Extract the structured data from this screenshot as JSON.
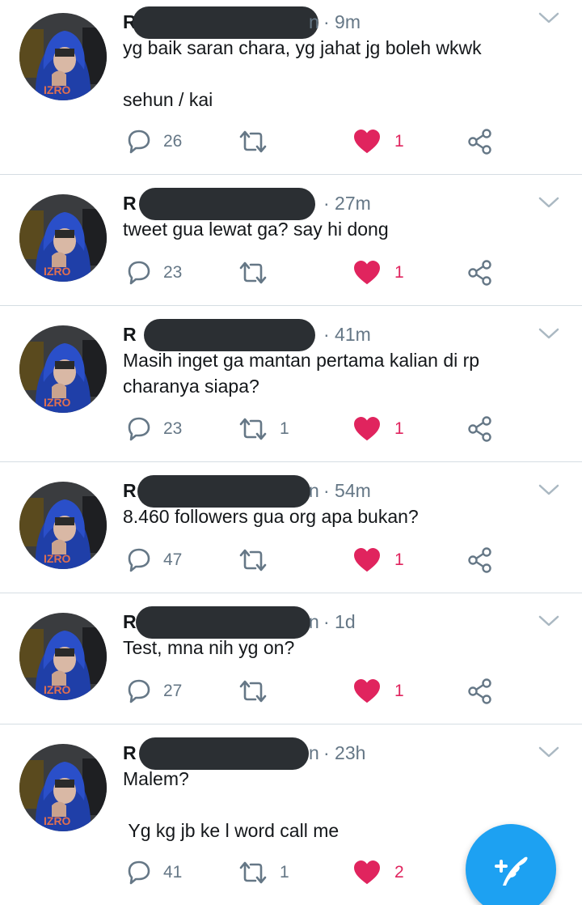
{
  "colors": {
    "accent": "#1da1f2",
    "like_active": "#e0245e",
    "secondary_text": "#657786",
    "divider": "#d5dde3",
    "redaction": "#2b2f33"
  },
  "tweets": [
    {
      "name_start": "R",
      "handle_end": "n",
      "time": "· 9m",
      "text": "yg baik saran chara, yg jahat jg boleh wkwk\n\nsehun / kai",
      "replies": "26",
      "retweets": "",
      "likes": "1",
      "liked": true
    },
    {
      "name_start": "R",
      "handle_end": "",
      "time": "· 27m",
      "text": "tweet gua lewat ga? say hi dong",
      "replies": "23",
      "retweets": "",
      "likes": "1",
      "liked": true
    },
    {
      "name_start": "R",
      "handle_end": "",
      "time": "· 41m",
      "text": "Masih inget ga mantan pertama kalian di rp\ncharanya siapa?",
      "replies": "23",
      "retweets": "1",
      "likes": "1",
      "liked": true
    },
    {
      "name_start": "R",
      "handle_end": "n",
      "time": "· 54m",
      "text": "8.460 followers gua org apa bukan?",
      "replies": "47",
      "retweets": "",
      "likes": "1",
      "liked": true
    },
    {
      "name_start": "R",
      "handle_end": "n",
      "time": "· 1d",
      "text": "Test, mna nih yg on?",
      "replies": "27",
      "retweets": "",
      "likes": "1",
      "liked": true
    },
    {
      "name_start": "R",
      "handle_end": "n",
      "time": "· 23h",
      "text": "Malem?\n\n Yg kg jb ke l word call me",
      "replies": "41",
      "retweets": "1",
      "likes": "2",
      "liked": true
    }
  ],
  "icons": {
    "reply": "reply-icon",
    "retweet": "retweet-icon",
    "like": "heart-icon",
    "share": "share-icon",
    "menu": "chevron-down-icon",
    "compose": "compose-tweet-icon"
  }
}
